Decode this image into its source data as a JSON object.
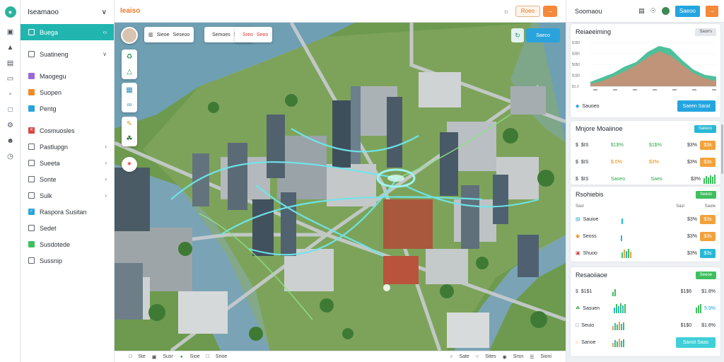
{
  "rail": {
    "icons": [
      "logo-icon",
      "layers-icon",
      "route-icon",
      "calendar-icon",
      "cube-icon",
      "inbox-icon",
      "folder-icon",
      "settings-icon",
      "user-icon",
      "clock-icon"
    ]
  },
  "sidebar": {
    "title": "Iseamaoo",
    "collapse": "∨",
    "items": [
      {
        "label": "Buega",
        "chev": "‹›",
        "active": true,
        "icon": "",
        "color": ""
      },
      {
        "label": "Suatineng",
        "chev": "∨",
        "active": false,
        "icon": "",
        "color": ""
      },
      {
        "label": "Maogegu",
        "chev": "",
        "active": false,
        "icon": "",
        "color": "#9a6ad8"
      },
      {
        "label": "Suopen",
        "chev": "",
        "active": false,
        "icon": "",
        "color": "#f08a2a"
      },
      {
        "label": "Pentg",
        "chev": "",
        "active": false,
        "icon": "",
        "color": "#2aa3dd"
      },
      {
        "label": "Cosmuosles",
        "chev": "",
        "active": false,
        "icon": "✕",
        "color": "#d44"
      },
      {
        "label": "Pastlupgn",
        "chev": "›",
        "active": false,
        "icon": "",
        "color": ""
      },
      {
        "label": "Sueeta",
        "chev": "›",
        "active": false,
        "icon": "",
        "color": ""
      },
      {
        "label": "Sonte",
        "chev": "›",
        "active": false,
        "icon": "",
        "color": ""
      },
      {
        "label": "Sulk",
        "chev": "›",
        "active": false,
        "icon": "",
        "color": ""
      },
      {
        "label": "Raspora Susitan",
        "chev": "",
        "active": false,
        "icon": "✓",
        "color": "#2aa3dd"
      },
      {
        "label": "Sedet",
        "chev": "",
        "active": false,
        "icon": "",
        "color": ""
      },
      {
        "label": "Susdotede",
        "chev": "",
        "active": false,
        "icon": "",
        "color": "#3fbf5f"
      },
      {
        "label": "Sussnip",
        "chev": "",
        "active": false,
        "icon": "",
        "color": ""
      }
    ]
  },
  "topbar": {
    "brand": "Ieaiso",
    "btn1": "Roeo",
    "btn2": "→"
  },
  "map": {
    "cards": [
      {
        "a": "Sieoe",
        "b": "Seseoo",
        "c": ""
      },
      {
        "a": "Semoes",
        "b": "Seewe",
        "c": ""
      },
      {
        "a": "Sreo",
        "b": "Seeo",
        "c": ""
      }
    ],
    "ctrl_btn": "Saeco"
  },
  "bottombar": {
    "items": [
      "Ste",
      "Susr",
      "Sioe",
      "Srioe",
      "Sate",
      "Sites",
      "Srsn",
      "Sioni"
    ]
  },
  "rpanel": {
    "title": "Soomaou",
    "top_btn": "Saeoo",
    "chart_card": {
      "title": "Reiaeeiming",
      "pill": "Saorrs",
      "footer_label": "Sauoeo",
      "footer_btn": "Saeen Sarat"
    },
    "major": {
      "title": "Mnjore Moaiinoe",
      "pill": "Sateoo",
      "rows": [
        {
          "a": "$IS",
          "b": "$1$%",
          "c": "$1$%",
          "d": "$3%",
          "tag": "$3s"
        },
        {
          "a": "$IS",
          "b": "$.0%",
          "c": "$3%",
          "d": "$3%",
          "tag": "$3s"
        },
        {
          "a": "$IS",
          "b": "Saoeo",
          "c": "Saeo",
          "d": "$3%",
          "tag": ""
        }
      ]
    },
    "prob": {
      "title": "Rsohiebis",
      "pill": "Seeos",
      "head": [
        "Sasl",
        "Sasl",
        "Saole"
      ],
      "rows": [
        {
          "a": "Sauioe",
          "d": "$3%",
          "tag": "$3s"
        },
        {
          "a": "Seoss",
          "d": "$3%",
          "tag": "$3s"
        },
        {
          "a": "Shuoo",
          "d": "$3%",
          "tag": "$3s"
        }
      ]
    },
    "econ": {
      "title": "Resaoiiaoe",
      "pill": "Seeoe",
      "rows": [
        {
          "a": "$1$1",
          "c": "$1$6",
          "d": "$1.8%"
        },
        {
          "a": "Sasuen",
          "c": "",
          "d": "5.9%"
        },
        {
          "a": "Seuio",
          "c": "$1$0",
          "d": "$1.8%"
        },
        {
          "a": "Sanoe",
          "c": "",
          "d": ""
        }
      ],
      "btn": "Sanot Saas"
    }
  },
  "chart_data": {
    "type": "area",
    "x": [
      "",
      "",
      "",
      "",
      "",
      "",
      "",
      "",
      ""
    ],
    "yticks": [
      "$1$0",
      "$3$0",
      "$0$0",
      "$1$0",
      "$1.0"
    ],
    "series": [
      {
        "values": [
          10,
          20,
          30,
          45,
          55,
          78,
          92,
          86,
          60,
          38,
          26,
          22
        ]
      },
      {
        "values": [
          5,
          12,
          22,
          34,
          48,
          66,
          80,
          70,
          50,
          30,
          18,
          12
        ]
      }
    ],
    "ylim": [
      0,
      100
    ],
    "colors": [
      "#2fb58a",
      "#f0826a"
    ]
  }
}
